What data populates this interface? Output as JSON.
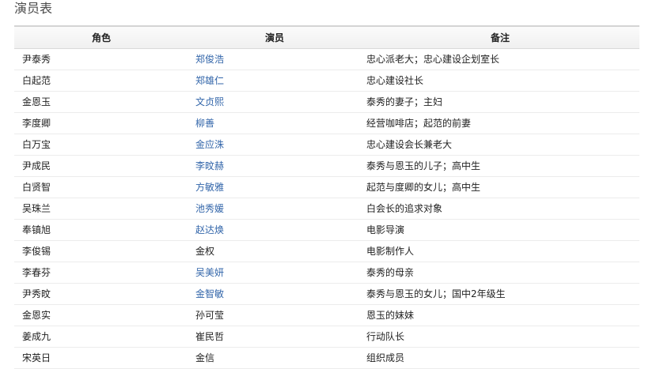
{
  "section": {
    "title": "演员表"
  },
  "table": {
    "headers": {
      "role": "角色",
      "actor": "演员",
      "note": "备注"
    },
    "rows": [
      {
        "role": "尹泰秀",
        "actor": "郑俊浩",
        "linked": true,
        "note": "忠心派老大；忠心建设企划室长"
      },
      {
        "role": "白起范",
        "actor": "郑雄仁",
        "linked": true,
        "note": "忠心建设社长"
      },
      {
        "role": "金恩玉",
        "actor": "文贞熙",
        "linked": true,
        "note": "泰秀的妻子；主妇"
      },
      {
        "role": "李度卿",
        "actor": "柳善",
        "linked": true,
        "note": "经营咖啡店；起范的前妻"
      },
      {
        "role": "白万宝",
        "actor": "金应洙",
        "linked": true,
        "note": "忠心建设会长兼老大"
      },
      {
        "role": "尹成民",
        "actor": "李旼赫",
        "linked": true,
        "note": "泰秀与恩玉的儿子；高中生"
      },
      {
        "role": "白贤智",
        "actor": "方敏雅",
        "linked": true,
        "note": "起范与度卿的女儿；高中生"
      },
      {
        "role": "吴珠兰",
        "actor": "池秀媛",
        "linked": true,
        "note": "白会长的追求对象"
      },
      {
        "role": "奉镇旭",
        "actor": "赵达焕",
        "linked": true,
        "note": "电影导演"
      },
      {
        "role": "李俊锡",
        "actor": "金权",
        "linked": false,
        "note": "电影制作人"
      },
      {
        "role": "李春芬",
        "actor": "吴美妍",
        "linked": true,
        "note": "泰秀的母亲"
      },
      {
        "role": "尹秀旼",
        "actor": "金智敏",
        "linked": true,
        "note": "泰秀与恩玉的女儿；国中2年级生"
      },
      {
        "role": "金恩实",
        "actor": "孙可莹",
        "linked": false,
        "note": "恩玉的妹妹"
      },
      {
        "role": "姜成九",
        "actor": "崔民哲",
        "linked": false,
        "note": "行动队长"
      },
      {
        "role": "宋英日",
        "actor": "金信",
        "linked": false,
        "note": "组织成员"
      }
    ]
  }
}
